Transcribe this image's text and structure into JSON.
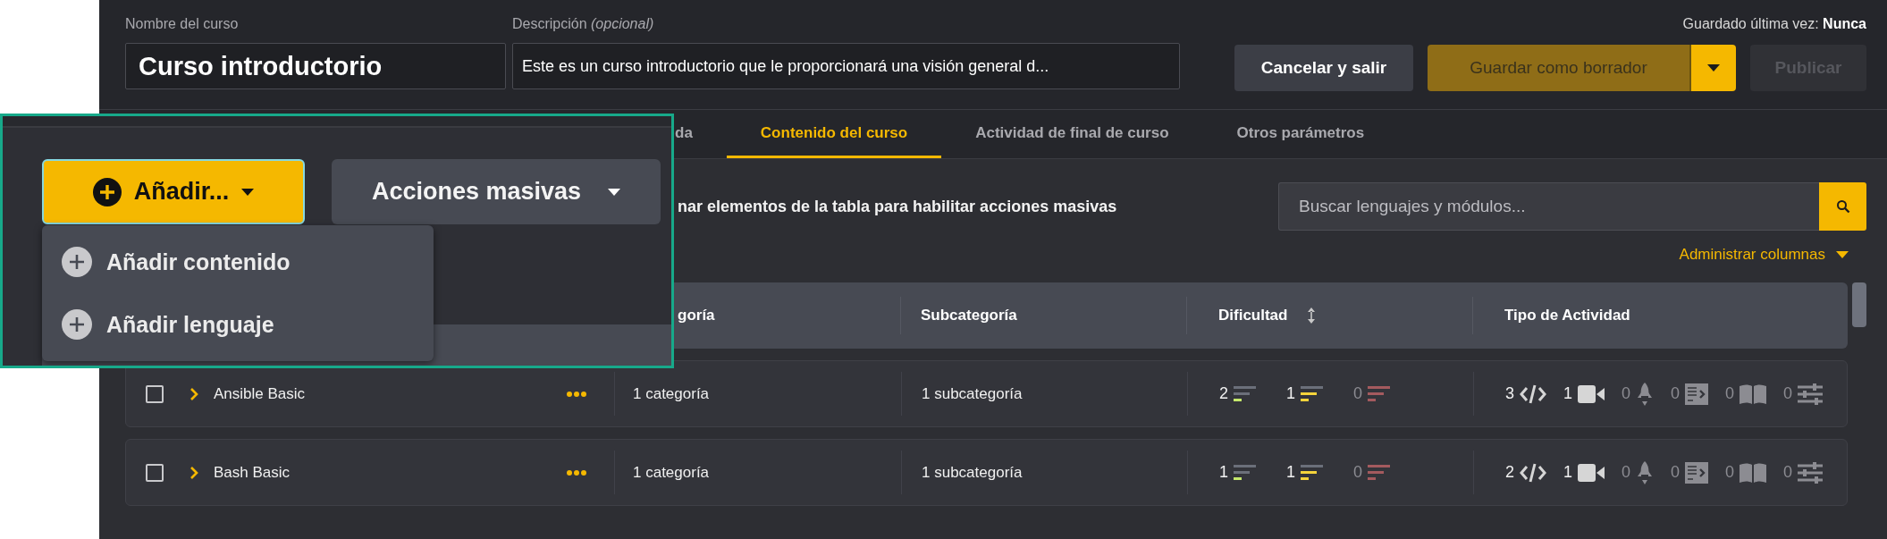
{
  "header": {
    "name_label": "Nombre del curso",
    "name_value": "Curso introductorio",
    "description_label": "Descripción *(opcional)*",
    "description_value": "Este es un curso introductorio que le proporcionará una visión general d...",
    "saved_label": "Guardado última vez: **Nunca**"
  },
  "buttons": [
    {
      "kind": "secondary",
      "label": "Cancelar y salir",
      "disabled": false
    },
    {
      "kind": "split",
      "label": "Guardar como borrador",
      "disabled": true
    },
    {
      "kind": "primary",
      "label": "Publicar",
      "disabled": true
    }
  ],
  "tabs": [
    {
      "label": "da",
      "selected": false
    },
    {
      "label": "Contenido del curso",
      "selected": true
    },
    {
      "label": "Actividad de final de curso",
      "selected": false
    },
    {
      "label": "Otros parámetros",
      "selected": false
    }
  ],
  "toolbar": {
    "hint": "nar elementos de la tabla para habilitar acciones masivas",
    "search": {
      "placeholder": "Buscar lenguajes y módulos..."
    },
    "manage_columns": "Administrar columnas"
  },
  "table": {
    "columns": [
      {
        "label": "goría",
        "sortable": false
      },
      {
        "label": "Subcategoría",
        "sortable": false
      },
      {
        "label": "Dificultad",
        "sortable": true
      },
      {
        "label": "Tipo de Actividad",
        "sortable": false
      }
    ],
    "rows": [
      {
        "checked": false,
        "expanded": false,
        "name": "Ansible Basic",
        "category": "1 categoría",
        "subcategory": "1 subcategoría",
        "difficulty": [
          {
            "kind": "easy",
            "count": "2",
            "muted": false
          },
          {
            "kind": "medium",
            "count": "1",
            "muted": false
          },
          {
            "kind": "hard",
            "count": "0",
            "muted": true
          }
        ],
        "activities": [
          {
            "kind": "code",
            "count": "3",
            "muted": false
          },
          {
            "kind": "video",
            "count": "1",
            "muted": false
          },
          {
            "kind": "rocket",
            "count": "0",
            "muted": true
          },
          {
            "kind": "slides",
            "count": "0",
            "muted": true
          },
          {
            "kind": "book",
            "count": "0",
            "muted": true
          },
          {
            "kind": "sliders",
            "count": "0",
            "muted": true
          }
        ]
      },
      {
        "checked": false,
        "expanded": false,
        "name": "Bash Basic",
        "category": "1 categoría",
        "subcategory": "1 subcategoría",
        "difficulty": [
          {
            "kind": "easy",
            "count": "1",
            "muted": false
          },
          {
            "kind": "medium",
            "count": "1",
            "muted": false
          },
          {
            "kind": "hard",
            "count": "0",
            "muted": true
          }
        ],
        "activities": [
          {
            "kind": "code",
            "count": "2",
            "muted": false
          },
          {
            "kind": "video",
            "count": "1",
            "muted": false
          },
          {
            "kind": "rocket",
            "count": "0",
            "muted": true
          },
          {
            "kind": "slides",
            "count": "0",
            "muted": true
          },
          {
            "kind": "book",
            "count": "0",
            "muted": true
          },
          {
            "kind": "sliders",
            "count": "0",
            "muted": true
          }
        ]
      }
    ]
  },
  "callout": {
    "add_button": "Añadir...",
    "bulk_button": "Acciones masivas",
    "menu": [
      {
        "label": "Añadir contenido"
      },
      {
        "label": "Añadir lenguaje"
      }
    ]
  }
}
